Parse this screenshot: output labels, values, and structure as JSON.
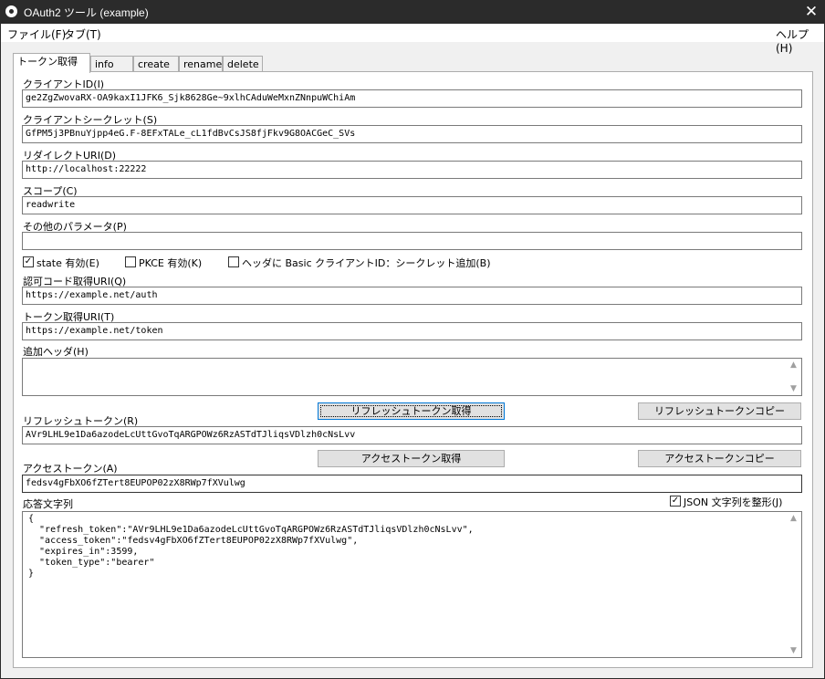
{
  "window": {
    "title": "OAuth2 ツール (example)",
    "close_glyph": "✕"
  },
  "menu": {
    "file": "ファイル(F)",
    "tab": "タブ(T)",
    "help": "ヘルプ(H)"
  },
  "tabs": [
    "トークン取得",
    "info",
    "create",
    "rename",
    "delete"
  ],
  "form": {
    "client_id_label": "クライアントID(I)",
    "client_id": "ge2ZgZwovaRX-OA9kaxI1JFK6_Sjk8628Ge~9xlhCAduWeMxnZNnpuWChiAm",
    "client_secret_label": "クライアントシークレット(S)",
    "client_secret": "GfPM5j3PBnuYjpp4eG.F-8EFxTALe_cL1fdBvCsJS8fjFkv9G8OACGeC_SVs",
    "redirect_label": "リダイレクトURI(D)",
    "redirect": "http://localhost:22222",
    "scope_label": "スコープ(C)",
    "scope": "readwrite",
    "other_params_label": "その他のパラメータ(P)",
    "other_params": "",
    "state_label": "state 有効(E)",
    "state_checked": true,
    "state_check_glyph": "✓",
    "pkce_label": "PKCE 有効(K)",
    "pkce_checked": false,
    "basic_label": "ヘッダに Basic クライアントID：シークレット追加(B)",
    "basic_checked": false,
    "auth_uri_label": "認可コード取得URI(Q)",
    "auth_uri": "https://example.net/auth",
    "token_uri_label": "トークン取得URI(T)",
    "token_uri": "https://example.net/token",
    "extra_headers_label": "追加ヘッダ(H)",
    "extra_headers": "",
    "refresh_get_button": "リフレッシュトークン取得",
    "refresh_copy_button": "リフレッシュトークンコピー",
    "refresh_label": "リフレッシュトークン(R)",
    "refresh_token": "AVr9LHL9e1Da6azodeLcUttGvoTqARGPOWz6RzASTdTJliqsVDlzh0cNsLvv",
    "access_get_button": "アクセストークン取得",
    "access_copy_button": "アクセストークンコピー",
    "access_label": "アクセストークン(A)",
    "access_token": "fedsv4gFbXO6fZTert8EUPOP02zX8RWp7fXVulwg",
    "response_label": "応答文字列",
    "json_format_label": "JSON 文字列を整形(J)",
    "json_format_checked": true,
    "json_check_glyph": "✓",
    "response_lines": [
      "{",
      "  \"refresh_token\":\"AVr9LHL9e1Da6azodeLcUttGvoTqARGPOWz6RzASTdTJliqsVDlzh0cNsLvv\",",
      "  \"access_token\":\"fedsv4gFbXO6fZTert8EUPOP02zX8RWp7fXVulwg\",",
      "  \"expires_in\":3599,",
      "  \"token_type\":\"bearer\"",
      "}"
    ]
  },
  "scroll": {
    "up": "▲",
    "down": "▼"
  }
}
